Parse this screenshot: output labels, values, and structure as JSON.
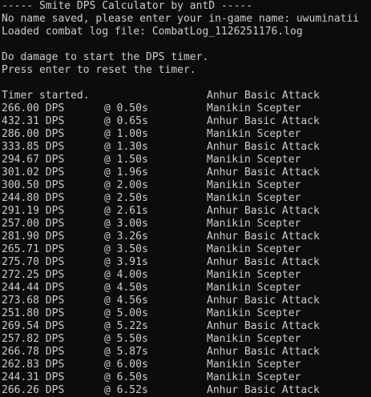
{
  "console": {
    "banner": "----- Smite DPS Calculator by antD -----",
    "no_name_msg": "No name saved, please enter your in-game name: uwuminatii",
    "loaded_msg": "Loaded combat log file: CombatLog_1126251176.log",
    "blank1": "",
    "start_msg": "Do damage to start the DPS timer.",
    "reset_msg": "Press enter to reset the timer.",
    "blank2": "",
    "timer_started": "Timer started.",
    "timer_ability": "Anhur Basic Attack",
    "rows": [
      {
        "dps": "266.00 DPS",
        "time": "@ 0.50s",
        "ability": "Manikin Scepter"
      },
      {
        "dps": "432.31 DPS",
        "time": "@ 0.65s",
        "ability": "Anhur Basic Attack"
      },
      {
        "dps": "286.00 DPS",
        "time": "@ 1.00s",
        "ability": "Manikin Scepter"
      },
      {
        "dps": "333.85 DPS",
        "time": "@ 1.30s",
        "ability": "Anhur Basic Attack"
      },
      {
        "dps": "294.67 DPS",
        "time": "@ 1.50s",
        "ability": "Manikin Scepter"
      },
      {
        "dps": "301.02 DPS",
        "time": "@ 1.96s",
        "ability": "Anhur Basic Attack"
      },
      {
        "dps": "300.50 DPS",
        "time": "@ 2.00s",
        "ability": "Manikin Scepter"
      },
      {
        "dps": "244.80 DPS",
        "time": "@ 2.50s",
        "ability": "Manikin Scepter"
      },
      {
        "dps": "291.19 DPS",
        "time": "@ 2.61s",
        "ability": "Anhur Basic Attack"
      },
      {
        "dps": "257.00 DPS",
        "time": "@ 3.00s",
        "ability": "Manikin Scepter"
      },
      {
        "dps": "281.90 DPS",
        "time": "@ 3.26s",
        "ability": "Anhur Basic Attack"
      },
      {
        "dps": "265.71 DPS",
        "time": "@ 3.50s",
        "ability": "Manikin Scepter"
      },
      {
        "dps": "275.70 DPS",
        "time": "@ 3.91s",
        "ability": "Anhur Basic Attack"
      },
      {
        "dps": "272.25 DPS",
        "time": "@ 4.00s",
        "ability": "Manikin Scepter"
      },
      {
        "dps": "244.44 DPS",
        "time": "@ 4.50s",
        "ability": "Manikin Scepter"
      },
      {
        "dps": "273.68 DPS",
        "time": "@ 4.56s",
        "ability": "Anhur Basic Attack"
      },
      {
        "dps": "251.80 DPS",
        "time": "@ 5.00s",
        "ability": "Manikin Scepter"
      },
      {
        "dps": "269.54 DPS",
        "time": "@ 5.22s",
        "ability": "Anhur Basic Attack"
      },
      {
        "dps": "257.82 DPS",
        "time": "@ 5.50s",
        "ability": "Manikin Scepter"
      },
      {
        "dps": "266.78 DPS",
        "time": "@ 5.87s",
        "ability": "Anhur Basic Attack"
      },
      {
        "dps": "262.83 DPS",
        "time": "@ 6.00s",
        "ability": "Manikin Scepter"
      },
      {
        "dps": "244.31 DPS",
        "time": "@ 6.50s",
        "ability": "Manikin Scepter"
      },
      {
        "dps": "266.26 DPS",
        "time": "@ 6.52s",
        "ability": "Anhur Basic Attack"
      }
    ]
  },
  "colors": {
    "background": "#0c0c0c",
    "text": "#cccccc"
  }
}
